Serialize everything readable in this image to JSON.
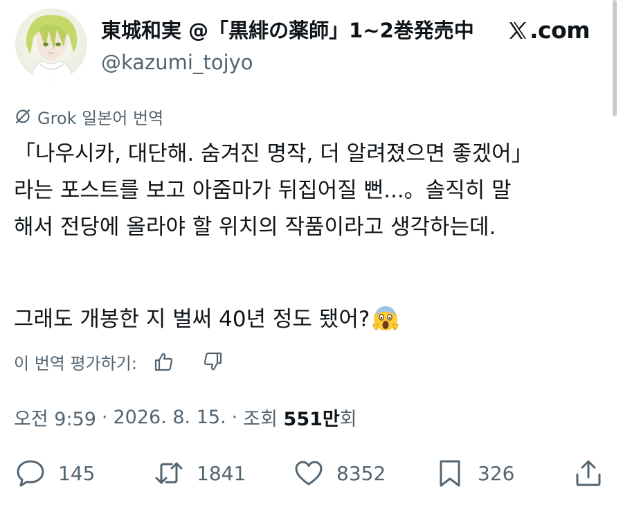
{
  "author": {
    "display_name": "東城和実 @「黒緋の薬師」1~2巻発売中",
    "handle": "@kazumi_tojyo",
    "avatar": "anime-character-avatar"
  },
  "brand": {
    "icon": "x-logo-icon",
    "domain": ".com"
  },
  "translation": {
    "icon": "grok-icon",
    "label": "Grok 일본어 번역"
  },
  "tweet": {
    "lines": [
      "「나우시카, 대단해. 숨겨진 명작, 더 알려졌으면 좋겠어」",
      "라는 포스트를 보고 아줌마가 뒤집어질 뻔...。솔직히 말",
      "해서 전당에 올라야 할 위치의 작품이라고 생각하는데.",
      "그래도 개봉한 지 벌써 40년 정도 됐어?"
    ],
    "emoji": "face-screaming-in-fear"
  },
  "rating": {
    "label": "이 번역 평가하기:",
    "up_icon": "thumbs-up-icon",
    "down_icon": "thumbs-down-icon"
  },
  "meta": {
    "time": "오전 9:59",
    "separator": "·",
    "date": "2026. 8. 15.",
    "views_label": "조회",
    "views_number": "551만",
    "views_unit": "회"
  },
  "actions": {
    "replies": "145",
    "reposts": "1841",
    "likes": "8352",
    "bookmarks": "326"
  },
  "colors": {
    "text": "#0f1419",
    "secondary": "#536471",
    "background": "#ffffff"
  }
}
